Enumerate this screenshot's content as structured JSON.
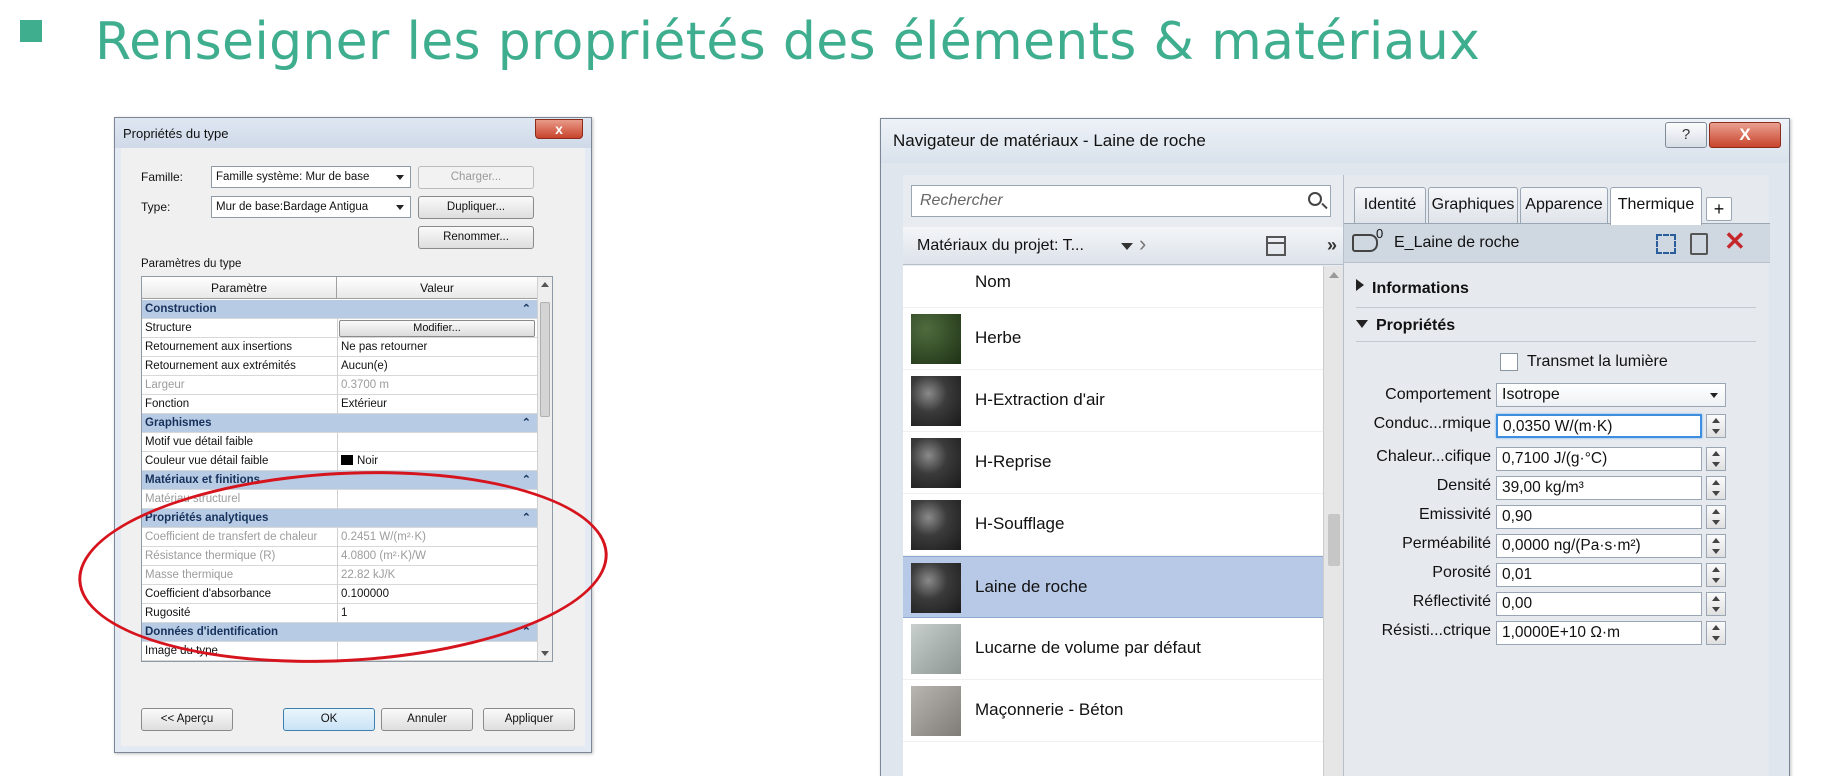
{
  "slide": {
    "title": "Renseigner les propriétés des éléments & matériaux",
    "accent_color": "#3fae8f",
    "highlight_color": "#d6141d"
  },
  "type_dialog": {
    "title": "Propriétés du type",
    "close": "x",
    "famille_label": "Famille:",
    "famille_value": "Famille système: Mur de base",
    "type_label": "Type:",
    "type_value": "Mur de base:Bardage Antigua",
    "btn_charger": "Charger...",
    "btn_dupliquer": "Dupliquer...",
    "btn_renommer": "Renommer...",
    "params_label": "Paramètres du type",
    "col_param": "Paramètre",
    "col_value": "Valeur",
    "sections": {
      "construction": "Construction",
      "graphismes": "Graphismes",
      "materiaux": "Matériaux et finitions",
      "analytiques": "Propriétés analytiques",
      "identification": "Données d'identification"
    },
    "rows": {
      "structure": {
        "k": "Structure",
        "v": "Modifier..."
      },
      "ret_insertions": {
        "k": "Retournement aux insertions",
        "v": "Ne pas retourner"
      },
      "ret_extremites": {
        "k": "Retournement aux extrémités",
        "v": "Aucun(e)"
      },
      "largeur": {
        "k": "Largeur",
        "v": "0.3700 m"
      },
      "fonction": {
        "k": "Fonction",
        "v": "Extérieur"
      },
      "motif": {
        "k": "Motif vue détail faible",
        "v": ""
      },
      "couleur": {
        "k": "Couleur vue détail faible",
        "v": "Noir"
      },
      "mat_struct": {
        "k": "Matériau structurel",
        "v": ""
      },
      "coef_transfert": {
        "k": "Coefficient de transfert de chaleur",
        "v": "0.2451 W/(m²·K)"
      },
      "resistance": {
        "k": "Résistance thermique (R)",
        "v": "4.0800 (m²·K)/W"
      },
      "masse": {
        "k": "Masse thermique",
        "v": "22.82 kJ/K"
      },
      "absorbance": {
        "k": "Coefficient d'absorbance",
        "v": "0.100000"
      },
      "rugosite": {
        "k": "Rugosité",
        "v": "1"
      },
      "image": {
        "k": "Image du type",
        "v": ""
      }
    },
    "btn_apercu": "<< Aperçu",
    "btn_ok": "OK",
    "btn_annuler": "Annuler",
    "btn_appliquer": "Appliquer"
  },
  "mat_dialog": {
    "title": "Navigateur de matériaux - Laine de roche",
    "help": "?",
    "close": "X",
    "search_placeholder": "Rechercher",
    "breadcrumb": "Matériaux du projet: T...",
    "more": "»",
    "list_header": "Nom",
    "materials": [
      {
        "name": "Herbe",
        "thumb": "herbe"
      },
      {
        "name": "H-Extraction d'air",
        "thumb": "dark"
      },
      {
        "name": "H-Reprise",
        "thumb": "dark"
      },
      {
        "name": "H-Soufflage",
        "thumb": "dark"
      },
      {
        "name": "Laine de roche",
        "thumb": "dark",
        "selected": true
      },
      {
        "name": "Lucarne de volume par défaut",
        "thumb": "glass"
      },
      {
        "name": "Maçonnerie - Béton",
        "thumb": "beton"
      }
    ],
    "tabs": [
      "Identité",
      "Graphiques",
      "Apparence",
      "Thermique",
      "+"
    ],
    "active_tab": "Thermique",
    "asset_count": "0",
    "asset_name": "E_Laine de roche",
    "section_info": "Informations",
    "section_props": "Propriétés",
    "transmet_label": "Transmet la lumière",
    "comportement_label": "Comportement",
    "comportement_value": "Isotrope",
    "props": [
      {
        "label": "Conduc...rmique",
        "value": "0,0350 W/(m·K)"
      },
      {
        "label": "Chaleur...cifique",
        "value": "0,7100 J/(g·°C)"
      },
      {
        "label": "Densité",
        "value": "39,00 kg/m³"
      },
      {
        "label": "Emissivité",
        "value": "0,90"
      },
      {
        "label": "Perméabilité",
        "value": "0,0000 ng/(Pa·s·m²)"
      },
      {
        "label": "Porosité",
        "value": "0,01"
      },
      {
        "label": "Réflectivité",
        "value": "0,00"
      },
      {
        "label": "Résisti...ctrique",
        "value": "1,0000E+10 Ω·m"
      }
    ]
  }
}
